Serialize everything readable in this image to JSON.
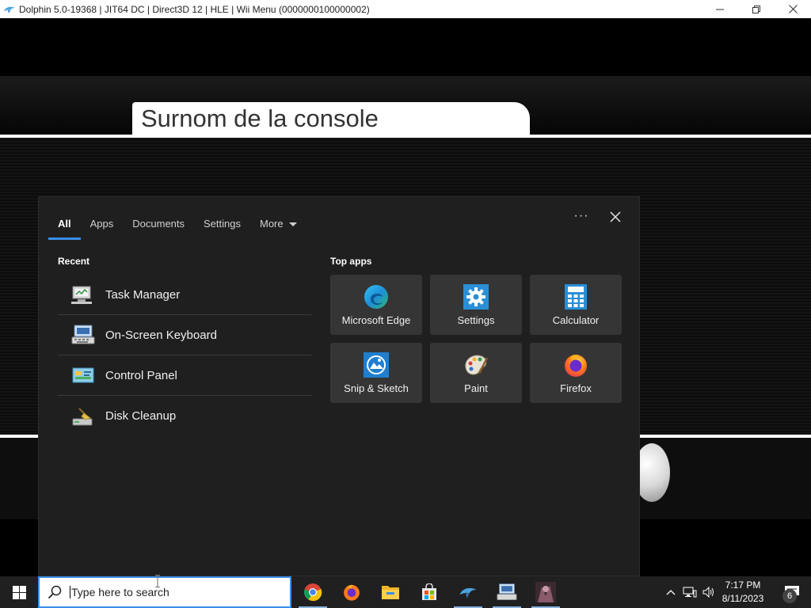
{
  "window": {
    "title": "Dolphin 5.0-19368 | JIT64 DC | Direct3D 12 | HLE | Wii Menu (0000000100000002)",
    "icon": "dolphin-icon",
    "controls": {
      "minimize": "minimize-icon",
      "restore": "restore-icon",
      "close": "close-icon"
    }
  },
  "game": {
    "nickname_label": "Surnom de la console"
  },
  "search_flyout": {
    "tabs": [
      {
        "label": "All",
        "active": true
      },
      {
        "label": "Apps"
      },
      {
        "label": "Documents"
      },
      {
        "label": "Settings"
      },
      {
        "label": "More"
      }
    ],
    "ellipsis": "···",
    "recent_label": "Recent",
    "recent_items": [
      {
        "label": "Task Manager",
        "icon": "task-manager-icon"
      },
      {
        "label": "On-Screen Keyboard",
        "icon": "keyboard-icon"
      },
      {
        "label": "Control Panel",
        "icon": "control-panel-icon"
      },
      {
        "label": "Disk Cleanup",
        "icon": "disk-cleanup-icon"
      }
    ],
    "top_apps_label": "Top apps",
    "top_apps": [
      {
        "label": "Microsoft Edge",
        "icon": "edge-icon"
      },
      {
        "label": "Settings",
        "icon": "settings-gear-icon"
      },
      {
        "label": "Calculator",
        "icon": "calculator-icon"
      },
      {
        "label": "Snip & Sketch",
        "icon": "snip-sketch-icon"
      },
      {
        "label": "Paint",
        "icon": "paint-icon"
      },
      {
        "label": "Firefox",
        "icon": "firefox-icon"
      }
    ]
  },
  "taskbar": {
    "search_placeholder": "Type here to search",
    "pinned": [
      {
        "name": "chrome",
        "icon": "chrome-icon"
      },
      {
        "name": "firefox",
        "icon": "firefox-icon"
      },
      {
        "name": "file-explorer",
        "icon": "folder-icon"
      },
      {
        "name": "microsoft-store",
        "icon": "store-icon"
      },
      {
        "name": "dolphin",
        "icon": "dolphin-icon"
      },
      {
        "name": "remote-desktop",
        "icon": "remote-desktop-icon"
      },
      {
        "name": "app-thumbnail",
        "icon": "app-thumbnail-icon"
      }
    ],
    "clock": {
      "time": "7:17 PM",
      "date": "8/11/2023"
    },
    "notification_count": "6"
  },
  "colors": {
    "accent": "#3a8ee6",
    "flyout_bg": "#1f1f1f",
    "tile_bg": "#353535",
    "taskbar_bg": "#202020"
  }
}
